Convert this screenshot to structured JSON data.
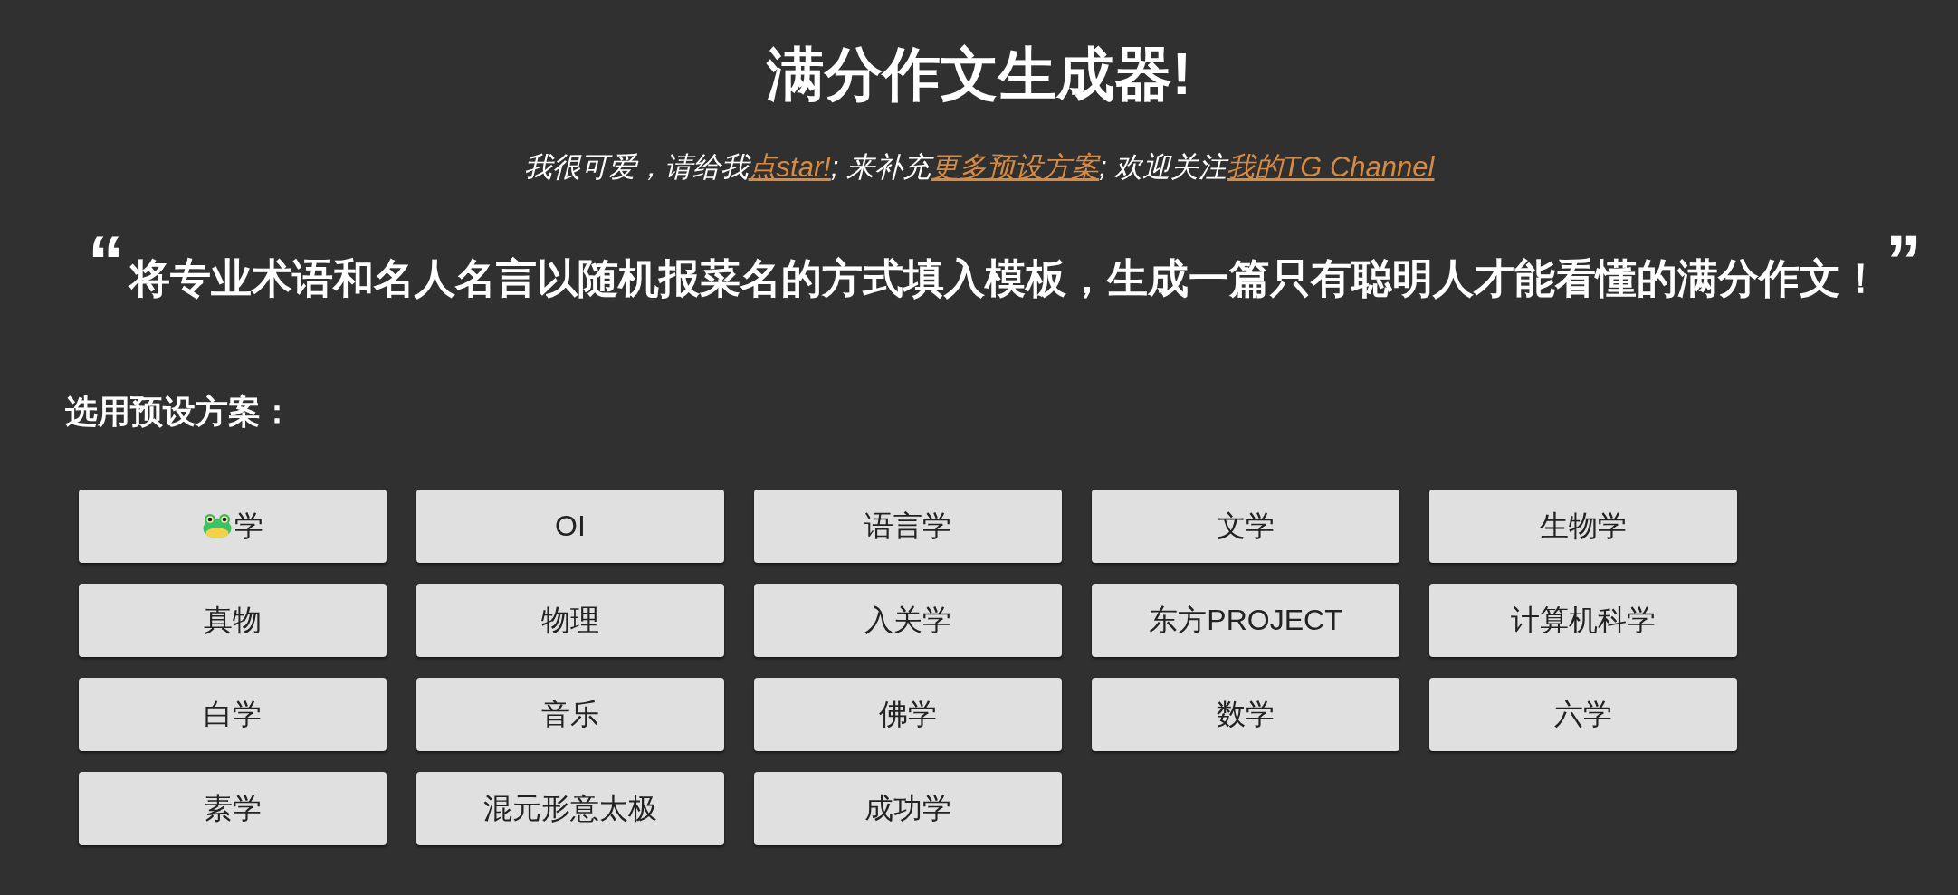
{
  "header": {
    "title": "满分作文生成器!",
    "subtitle": [
      {
        "kind": "text",
        "text": "我很可爱，请给我"
      },
      {
        "kind": "link",
        "text": "点star!"
      },
      {
        "kind": "text",
        "text": "; 来补充"
      },
      {
        "kind": "link",
        "text": "更多预设方案"
      },
      {
        "kind": "text",
        "text": "; 欢迎关注"
      },
      {
        "kind": "link",
        "text": "我的TG Channel"
      }
    ]
  },
  "quote": {
    "open_mark": "“",
    "text": "将专业术语和名人名言以随机报菜名的方式填入模板，生成一篇只有聪明人才能看懂的满分作文！",
    "close_mark": "”"
  },
  "presets": {
    "heading": "选用预设方案：",
    "buttons": [
      {
        "label": "学",
        "icon": true
      },
      {
        "label": "OI",
        "icon": false
      },
      {
        "label": "语言学",
        "icon": false
      },
      {
        "label": "文学",
        "icon": false
      },
      {
        "label": "生物学",
        "icon": false
      },
      {
        "label": "真物",
        "icon": false
      },
      {
        "label": "物理",
        "icon": false
      },
      {
        "label": "入关学",
        "icon": false
      },
      {
        "label": "东方PROJECT",
        "icon": false
      },
      {
        "label": "计算机科学",
        "icon": false
      },
      {
        "label": "白学",
        "icon": false
      },
      {
        "label": "音乐",
        "icon": false
      },
      {
        "label": "佛学",
        "icon": false
      },
      {
        "label": "数学",
        "icon": false
      },
      {
        "label": "六学",
        "icon": false
      },
      {
        "label": "素学",
        "icon": false
      },
      {
        "label": "混元形意太极",
        "icon": false
      },
      {
        "label": "成功学",
        "icon": false
      }
    ]
  }
}
